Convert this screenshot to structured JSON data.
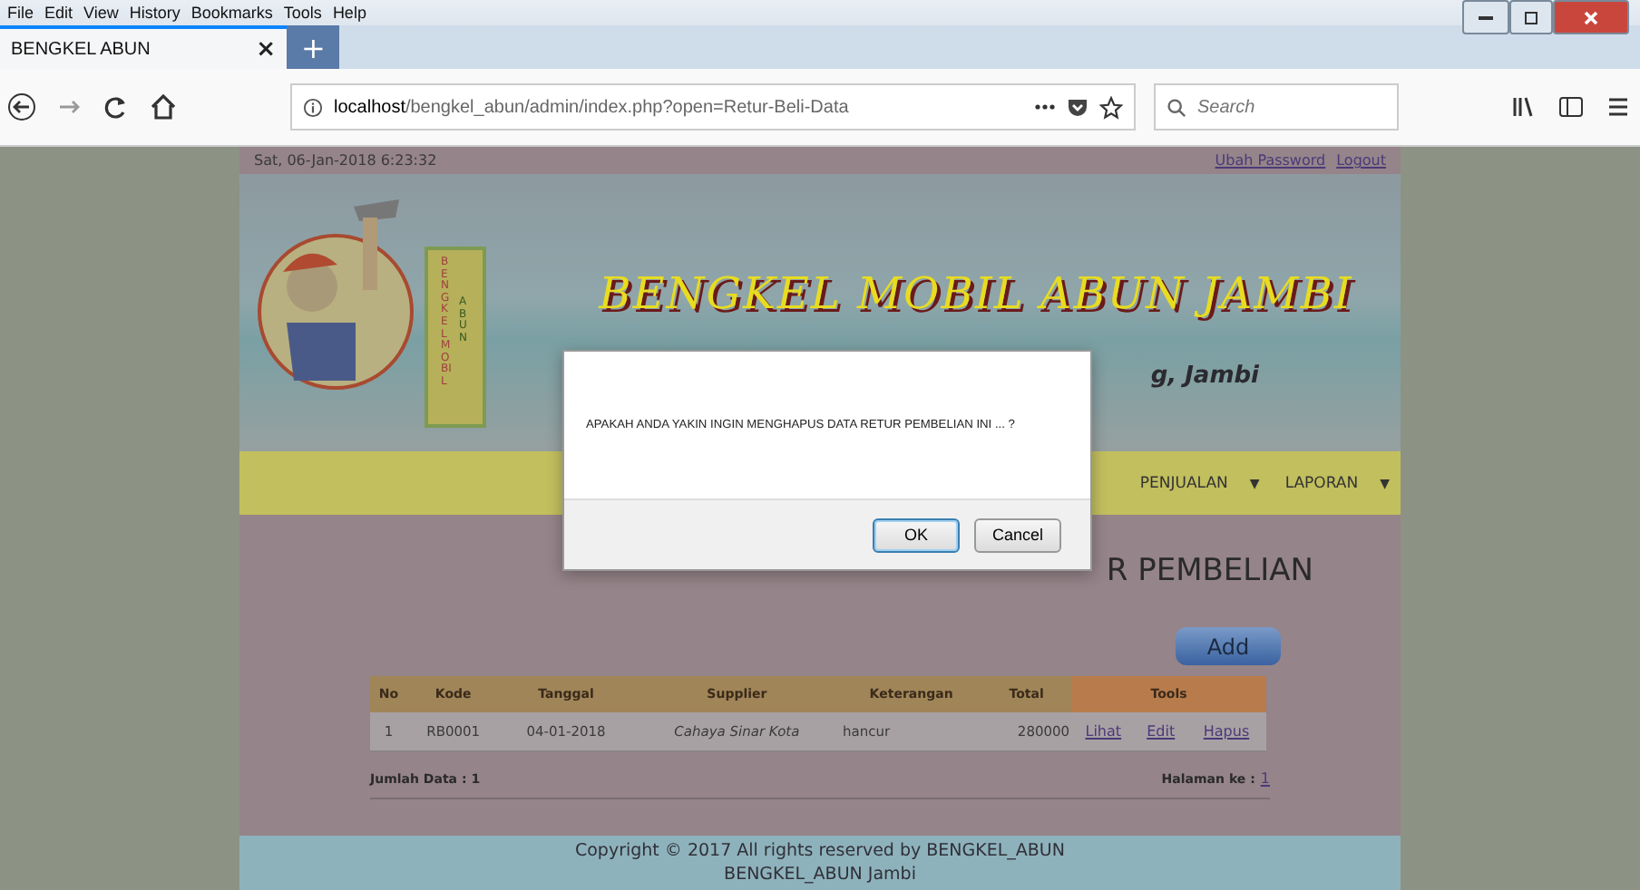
{
  "menu_bar": [
    "File",
    "Edit",
    "View",
    "History",
    "Bookmarks",
    "Tools",
    "Help"
  ],
  "tab": {
    "title": "BENGKEL ABUN",
    "close": "×",
    "new_tab": "+"
  },
  "address_bar": {
    "host": "localhost",
    "path": "/bengkel_abun/admin/index.php?open=Retur-Beli-Data"
  },
  "search": {
    "placeholder": "Search"
  },
  "page": {
    "datetime": "Sat, 06-Jan-2018 6:23:32",
    "top_links": [
      "Ubah Password",
      "Logout"
    ],
    "logo_sign": {
      "column_1": "BENGKEL MOBIL",
      "column_2": "ABUN"
    },
    "banner_title": "BENGKEL MOBIL ABUN JAMBI",
    "banner_subtitle": "g, Jambi",
    "nav": [
      {
        "label": "PENJUALAN",
        "caret": "▼"
      },
      {
        "label": "LAPORAN",
        "caret": "▼"
      }
    ],
    "heading": "R PEMBELIAN",
    "add_button": "Add",
    "table": {
      "columns": [
        "No",
        "Kode",
        "Tanggal",
        "Supplier",
        "Keterangan",
        "Total",
        "Tools"
      ],
      "rows": [
        {
          "cells": [
            "1",
            "RB0001",
            "04-01-2018",
            "Cahaya Sinar Kota",
            "hancur",
            "280000"
          ],
          "actions": [
            "Lihat",
            "Edit",
            "Hapus"
          ]
        }
      ]
    },
    "count_label": "Jumlah Data : 1",
    "page_label": "Halaman ke :",
    "pages": [
      "1"
    ],
    "footer": [
      "Copyright © 2017 All rights reserved by BENGKEL_ABUN",
      "BENGKEL_ABUN Jambi"
    ]
  },
  "dialog": {
    "message": "APAKAH ANDA YAKIN INGIN MENGHAPUS DATA RETUR PEMBELIAN INI ... ?",
    "buttons": [
      {
        "label": "OK",
        "selected": true
      },
      {
        "label": "Cancel",
        "selected": false
      }
    ]
  }
}
